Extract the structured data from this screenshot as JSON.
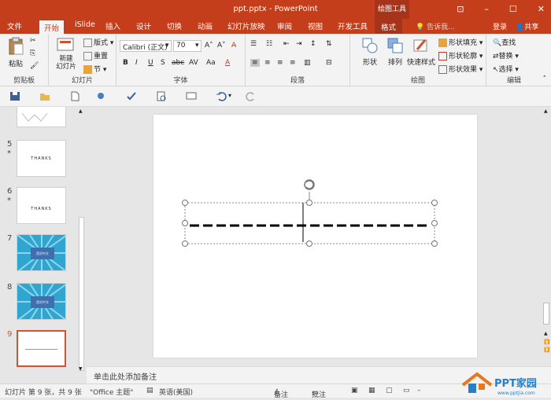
{
  "titlebar": {
    "doc_title": "ppt.pptx - PowerPoint",
    "context_tab": "绘图工具"
  },
  "tabs": [
    "文件",
    "开始",
    "iSlide",
    "插入",
    "设计",
    "切换",
    "动画",
    "幻灯片放映",
    "审阅",
    "视图",
    "开发工具",
    "格式"
  ],
  "tell_me": "告诉我...",
  "login": "登录",
  "share": "共享",
  "ribbon": {
    "clipboard": {
      "paste": "粘贴",
      "label": "剪贴板"
    },
    "slides": {
      "new_slide": "新建\n幻灯片",
      "layout": "版式",
      "reset": "重置",
      "section": "节",
      "label": "幻灯片"
    },
    "font": {
      "font_name": "Calibri (正文)",
      "font_size": "70",
      "label": "字体"
    },
    "paragraph": {
      "label": "段落"
    },
    "drawing": {
      "shapes": "形状",
      "arrange": "排列",
      "quick_styles": "快速样式",
      "fill": "形状填充",
      "outline": "形状轮廓",
      "effects": "形状效果",
      "label": "绘图"
    },
    "editing": {
      "find": "查找",
      "replace": "替换",
      "select": "选择",
      "label": "编辑"
    }
  },
  "slides_pane": {
    "items": [
      {
        "num": "5",
        "star": "*",
        "text": "THANKS",
        "style": "white"
      },
      {
        "num": "6",
        "star": "*",
        "text": "THANKS",
        "style": "white"
      },
      {
        "num": "7",
        "text": "是初中文",
        "style": "blue"
      },
      {
        "num": "8",
        "text": "是初中文",
        "style": "blue"
      },
      {
        "num": "9",
        "text": "",
        "style": "selected"
      }
    ]
  },
  "notes_placeholder": "单击此处添加备注",
  "status": {
    "slide_info": "幻灯片 第 9 张，共 9 张",
    "theme": "\"Office 主题\"",
    "language": "英语(美国)",
    "notes": "备注",
    "comments": "批注"
  },
  "watermark": {
    "brand": "PPT家园",
    "url": "www.pptjia.com"
  },
  "colors": {
    "accent": "#c43e1c",
    "accent_dark": "#a6341a",
    "selection": "#d35230"
  }
}
